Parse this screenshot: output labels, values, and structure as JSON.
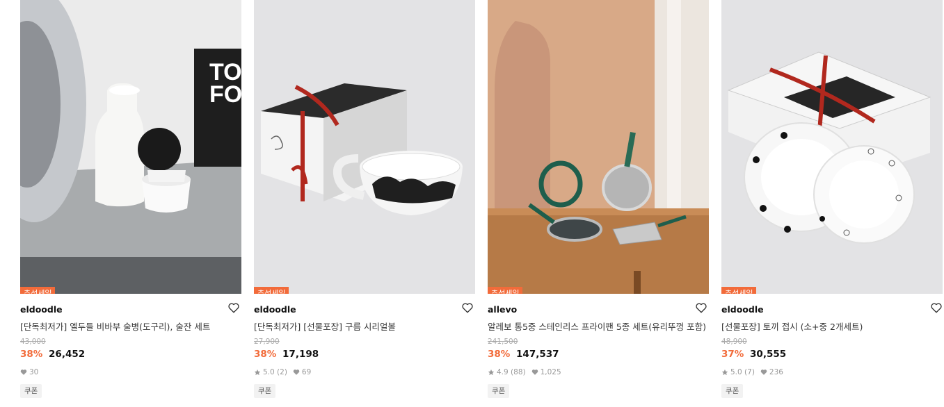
{
  "products": [
    {
      "badge": "추석세일",
      "brand": "eldoodle",
      "title": "[단독최저가] 엘두들 비바부 술병(도구리), 술잔 세트",
      "original_price": "43,000",
      "discount": "38%",
      "price": "26,452",
      "rating": "",
      "likes": "30",
      "coupon": "쿠폰",
      "image_icon": "sake-bottle-set-image",
      "image_text": [
        "TO",
        "FO"
      ]
    },
    {
      "badge": "추석세일",
      "brand": "eldoodle",
      "title": "[단독최저가] [선물포장] 구름 시리얼볼",
      "original_price": "27,900",
      "discount": "38%",
      "price": "17,198",
      "rating": "5.0 (2)",
      "likes": "69",
      "coupon": "쿠폰",
      "image_icon": "cereal-bowl-gift-box-image"
    },
    {
      "badge": "추석세일",
      "brand": "allevo",
      "title": "알레보 통5중 스테인리스 프라이팬 5종 세트(유리뚜껑 포함)",
      "original_price": "241,500",
      "discount": "38%",
      "price": "147,537",
      "rating": "4.9 (88)",
      "likes": "1,025",
      "coupon": "쿠폰",
      "image_icon": "frying-pan-set-image"
    },
    {
      "badge": "추석세일",
      "brand": "eldoodle",
      "title": "[선물포장] 토끼 접시 (소+중 2개세트)",
      "original_price": "48,900",
      "discount": "37%",
      "price": "30,555",
      "rating": "5.0 (7)",
      "likes": "236",
      "coupon": "쿠폰",
      "image_icon": "rabbit-plate-set-image"
    }
  ],
  "colors": {
    "accent": "#f26b3a",
    "muted": "#999999",
    "coupon_bg": "#f2f2f2"
  }
}
